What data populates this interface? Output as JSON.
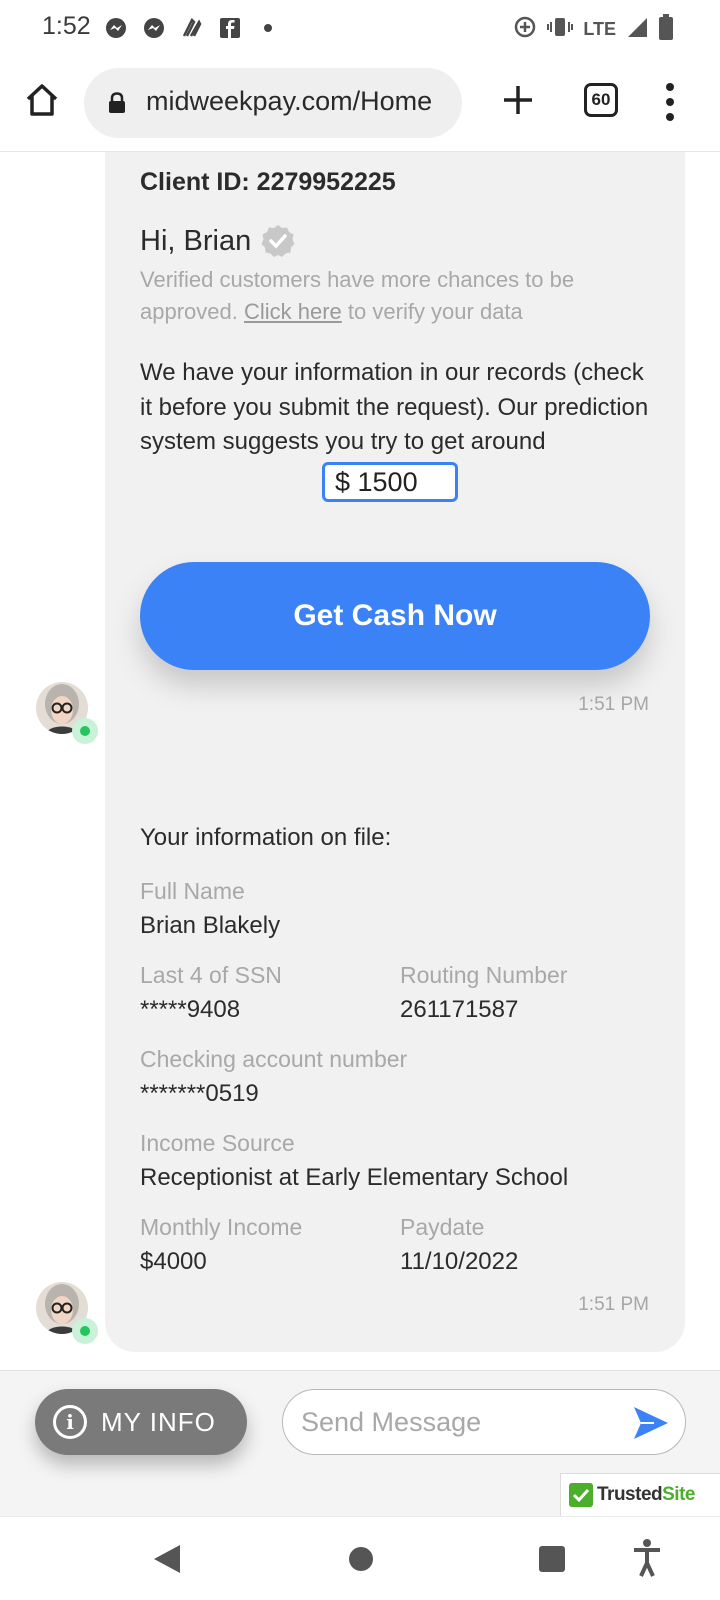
{
  "status_bar": {
    "time": "1:52",
    "network": "LTE",
    "icons": [
      "messenger-icon",
      "messenger-icon",
      "app-icon",
      "facebook-icon",
      "dot-icon",
      "data-saver-icon",
      "vibrate-icon",
      "signal-icon",
      "battery-icon"
    ]
  },
  "browser": {
    "url": "midweekpay.com/Home",
    "tab_count": "60"
  },
  "chat": {
    "message1": {
      "client_id": "Client ID: 2279952225",
      "greeting": "Hi, Brian",
      "verify_note_pre": "Verified customers have more chances to be approved.",
      "verify_link": "Click here",
      "verify_note_post": "to verify your data",
      "records_text": "We have your information in our records (check it before you submit the request). Our prediction system suggests you try to get around",
      "amount_value": "$ 1500",
      "cta_label": "Get Cash Now",
      "time": "1:51 PM"
    },
    "message2": {
      "title": "Your information on file:",
      "full_name_label": "Full Name",
      "full_name": "Brian Blakely",
      "ssn_label": "Last 4 of SSN",
      "ssn": "*****9408",
      "routing_label": "Routing Number",
      "routing": "261171587",
      "checking_label": "Checking account number",
      "checking": "*******0519",
      "income_source_label": "Income Source",
      "income_source": "Receptionist at Early Elementary School",
      "monthly_income_label": "Monthly Income",
      "monthly_income": "$4000",
      "paydate_label": "Paydate",
      "paydate": "11/10/2022",
      "time": "1:51 PM"
    }
  },
  "input_bar": {
    "my_info_label": "MY INFO",
    "message_placeholder": "Send Message",
    "trusted_badge": "TrustedSite"
  },
  "colors": {
    "accent": "#3b82f6",
    "bubble_bg": "#f1f1f1",
    "muted_text": "#a8a8a8",
    "online": "#22c55e",
    "trusted_green": "#4caf2b"
  }
}
